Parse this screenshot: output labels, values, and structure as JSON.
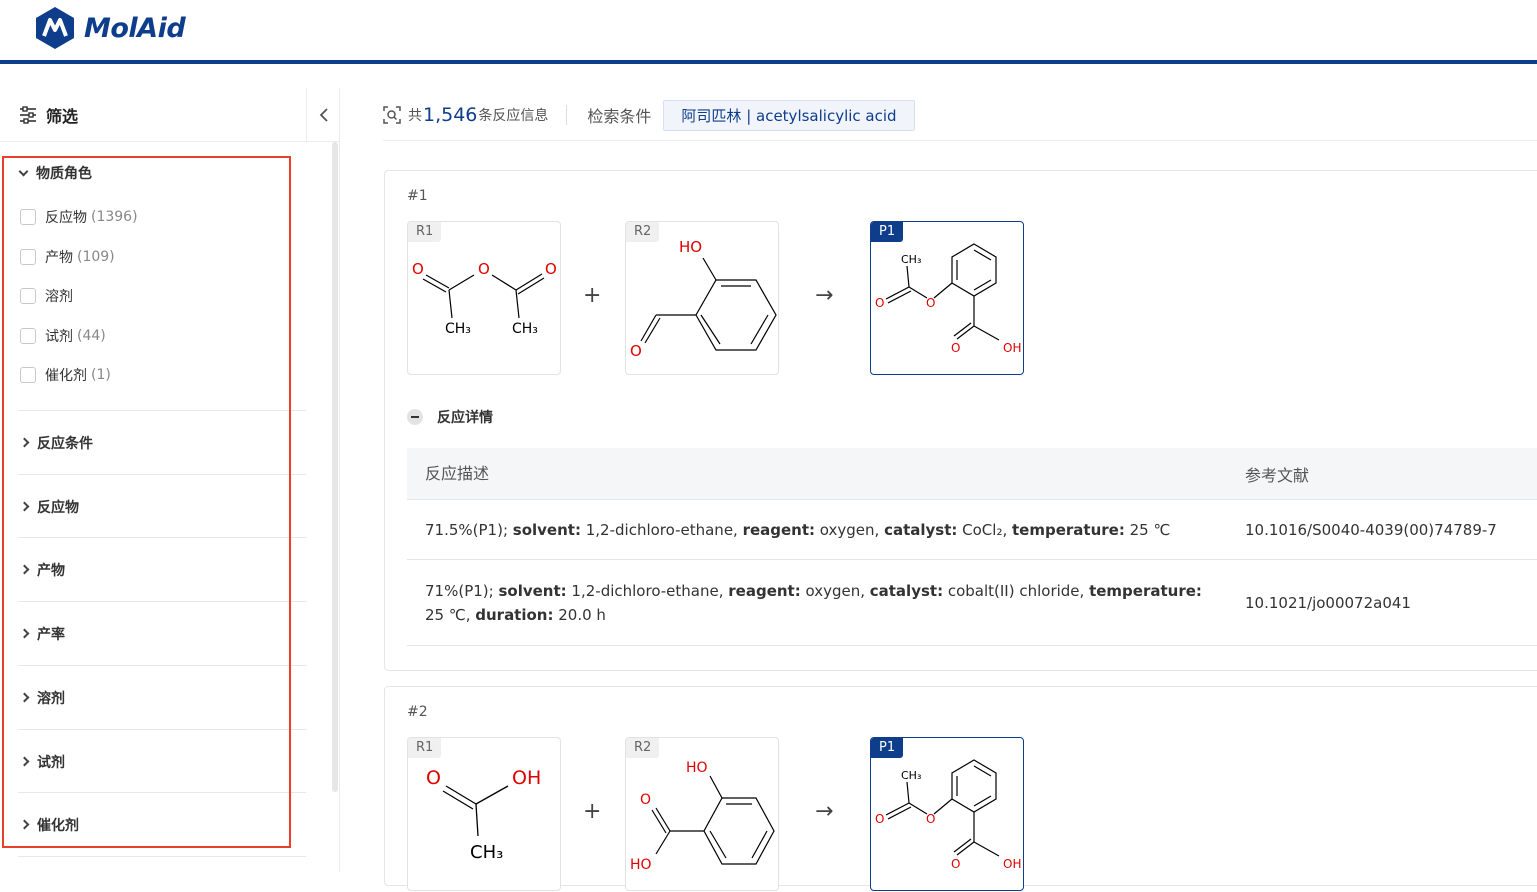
{
  "app": {
    "logo_text": "MolAid"
  },
  "sidebar": {
    "title": "筛选",
    "role_section": {
      "title": "物质角色",
      "options": [
        {
          "label": "反应物",
          "count": "(1396)"
        },
        {
          "label": "产物",
          "count": "(109)"
        },
        {
          "label": "溶剂",
          "count": ""
        },
        {
          "label": "试剂",
          "count": "(44)"
        },
        {
          "label": "催化剂",
          "count": "(1)"
        }
      ]
    },
    "sections": [
      "反应条件",
      "反应物",
      "产物",
      "产率",
      "溶剂",
      "试剂",
      "催化剂"
    ]
  },
  "summary": {
    "prefix": "共",
    "count": "1,546",
    "suffix": "条反应信息",
    "condition_label": "检索条件",
    "query": "阿司匹林 | acetylsalicylic acid"
  },
  "reactions": [
    {
      "index": "#1",
      "r1_tag": "R1",
      "r2_tag": "R2",
      "p1_tag": "P1",
      "plus": "+",
      "arrow": "→",
      "details_label": "反应详情",
      "table": {
        "col_desc": "反应描述",
        "col_ref": "参考文献",
        "rows": [
          {
            "yield": "71.5%(P1); ",
            "solvent_label": "solvent:",
            "solvent": " 1,2-dichloro-ethane, ",
            "reagent_label": "reagent:",
            "reagent": " oxygen, ",
            "catalyst_label": "catalyst:",
            "catalyst": " CoCl₂, ",
            "temperature_label": "temperature:",
            "temperature": " 25 ℃",
            "ref": "10.1016/S0040-4039(00)74789-7"
          },
          {
            "yield": "71%(P1); ",
            "solvent_label": "solvent:",
            "solvent": " 1,2-dichloro-ethane, ",
            "reagent_label": "reagent:",
            "reagent": " oxygen, ",
            "catalyst_label": "catalyst:",
            "catalyst": " cobalt(II) chloride, ",
            "temperature_label": "temperature:",
            "temperature": " 25 ℃, ",
            "duration_label": "duration:",
            "duration": " 20.0 h",
            "ref": "10.1021/jo00072a041"
          }
        ]
      }
    },
    {
      "index": "#2",
      "r1_tag": "R1",
      "r2_tag": "R2",
      "p1_tag": "P1",
      "plus": "+",
      "arrow": "→"
    }
  ],
  "molecule_labels": {
    "acetic_anhydride": {
      "o1": "O",
      "o2": "O",
      "o3": "O",
      "ch3a": "CH₃",
      "ch3b": "CH₃"
    },
    "salicylaldehyde": {
      "ho": "HO",
      "o": "O"
    },
    "aspirin": {
      "ch3": "CH₃",
      "o1": "O",
      "o2": "O",
      "o3": "O",
      "oh": "OH"
    },
    "acetic_acid": {
      "o": "O",
      "oh": "OH",
      "ch3": "CH₃"
    },
    "salicylic_acid": {
      "ho1": "HO",
      "o": "O",
      "ho2": "HO"
    }
  },
  "colors": {
    "brand": "#0e3d8c",
    "highlight": "#e8402a",
    "heteroatom": "#e00000"
  }
}
